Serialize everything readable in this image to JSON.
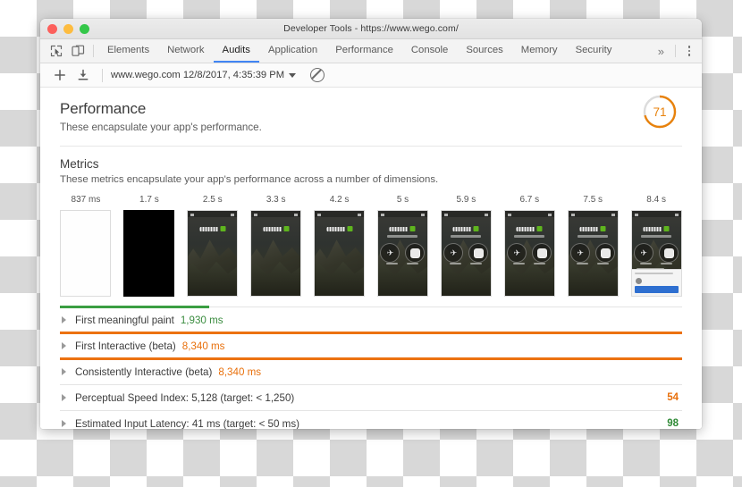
{
  "window": {
    "title": "Developer Tools - https://www.wego.com/",
    "traffic_lights": [
      "close-button",
      "minimize-button",
      "maximize-button"
    ]
  },
  "tabbar": {
    "left_icons": [
      "inspect-element-icon",
      "device-toolbar-icon"
    ],
    "tabs": [
      {
        "label": "Elements",
        "active": false
      },
      {
        "label": "Network",
        "active": false
      },
      {
        "label": "Audits",
        "active": true
      },
      {
        "label": "Application",
        "active": false
      },
      {
        "label": "Performance",
        "active": false
      },
      {
        "label": "Console",
        "active": false
      },
      {
        "label": "Sources",
        "active": false
      },
      {
        "label": "Memory",
        "active": false
      },
      {
        "label": "Security",
        "active": false
      }
    ],
    "overflow_label": "»",
    "menu_icon": "kebab-menu-icon"
  },
  "audit_toolbar": {
    "add_label": "+",
    "download_icon": "download-icon",
    "run_label": "www.wego.com 12/8/2017, 4:35:39 PM",
    "dropdown_icon": "chevron-down-icon",
    "clear_icon": "no-entry-icon"
  },
  "performance": {
    "title": "Performance",
    "subtitle": "These encapsulate your app's performance.",
    "score": "71",
    "score_value": 71,
    "score_color": "#e8820c",
    "track_color": "#dcdcdc"
  },
  "metrics_section": {
    "title": "Metrics",
    "subtitle": "These metrics encapsulate your app's performance across a number of dimensions."
  },
  "filmstrip": {
    "frames": [
      {
        "label": "837 ms",
        "kind": "blank"
      },
      {
        "label": "1.7 s",
        "kind": "black"
      },
      {
        "label": "2.5 s",
        "kind": "hero"
      },
      {
        "label": "3.3 s",
        "kind": "hero"
      },
      {
        "label": "4.2 s",
        "kind": "hero"
      },
      {
        "label": "5 s",
        "kind": "buttons"
      },
      {
        "label": "5.9 s",
        "kind": "buttons"
      },
      {
        "label": "6.7 s",
        "kind": "buttons"
      },
      {
        "label": "7.5 s",
        "kind": "buttons"
      },
      {
        "label": "8.4 s",
        "kind": "full"
      }
    ]
  },
  "metrics": [
    {
      "label": "First meaningful paint",
      "value": "1,930 ms",
      "value_color": "green",
      "bar_color": "#3a9e42",
      "bar_percent": 24
    },
    {
      "label": "First Interactive (beta)",
      "value": "8,340 ms",
      "value_color": "orange",
      "bar_color": "#ec7211",
      "bar_percent": 100
    },
    {
      "label": "Consistently Interactive (beta)",
      "value": "8,340 ms",
      "value_color": "orange",
      "bar_color": "#ec7211",
      "bar_percent": 100
    }
  ],
  "simple_metrics": [
    {
      "label": "Perceptual Speed Index: 5,128 (target: < 1,250)",
      "score": "54",
      "score_color": "orange"
    },
    {
      "label": "Estimated Input Latency: 41 ms (target: < 50 ms)",
      "score": "98",
      "score_color": "green"
    }
  ]
}
